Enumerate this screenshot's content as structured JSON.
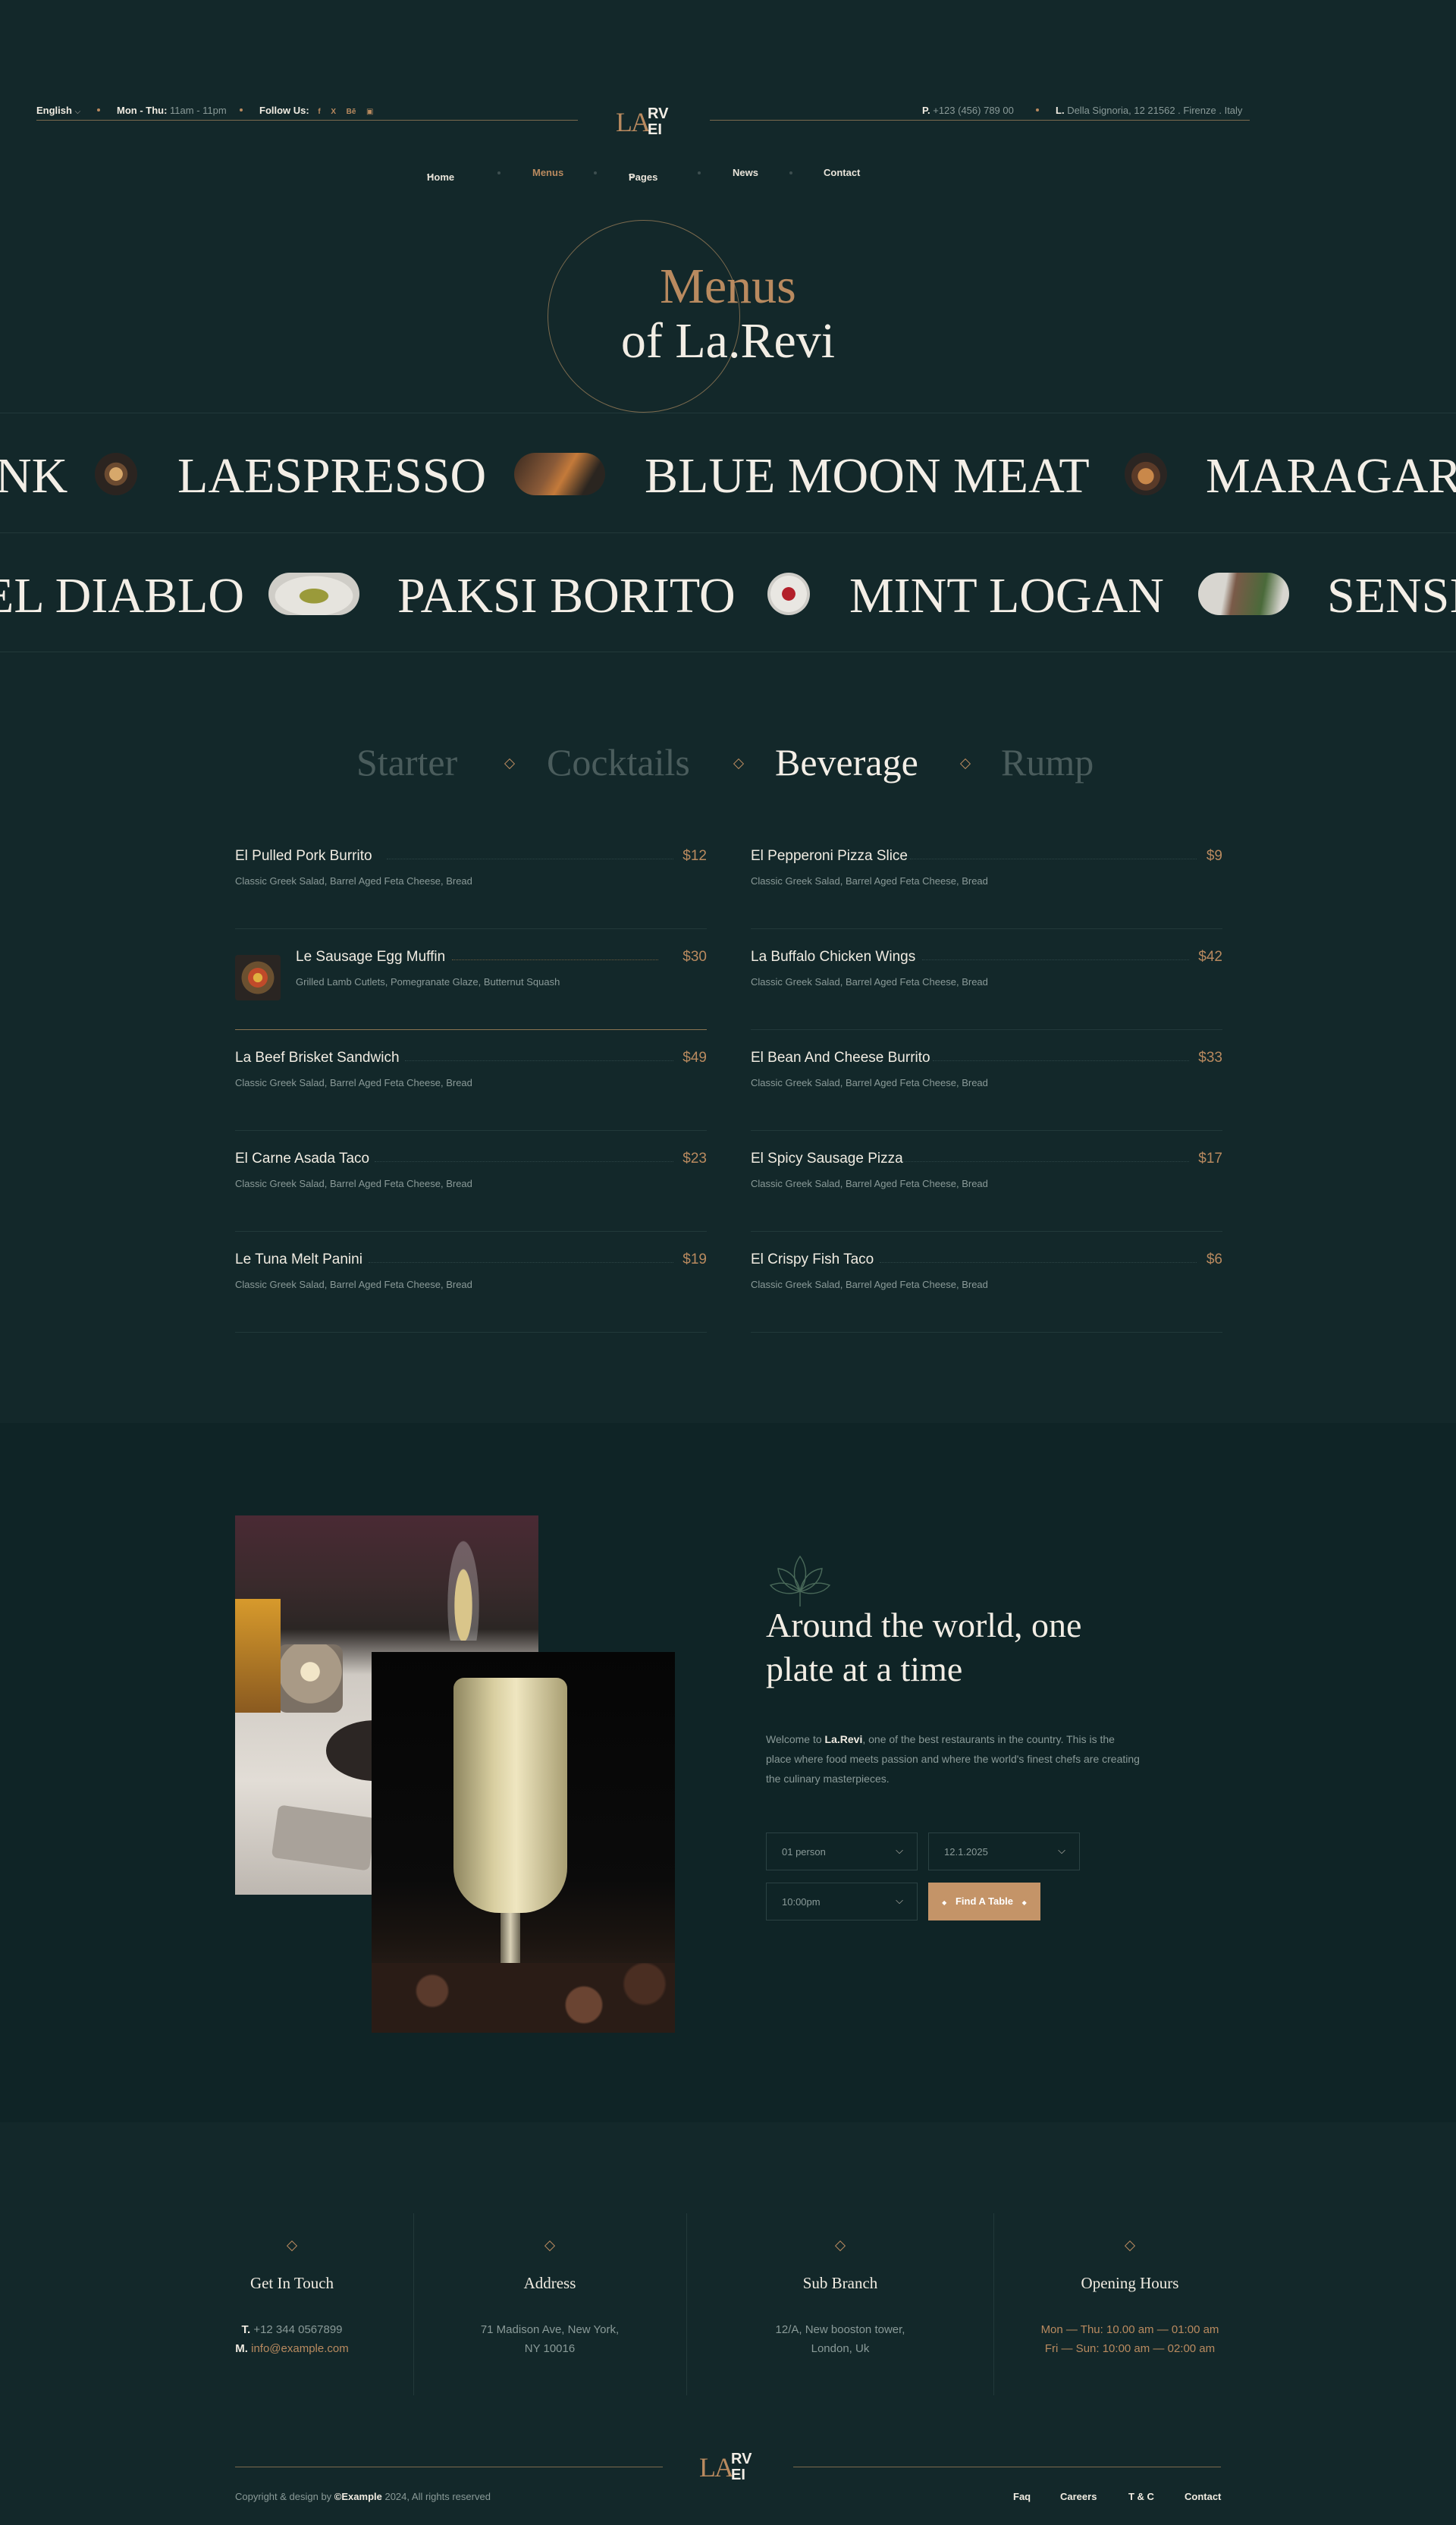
{
  "topbar": {
    "language": "English",
    "hours_label": "Mon - Thu:",
    "hours_value": "11am - 11pm",
    "follow_label": "Follow Us:",
    "socials": [
      "f",
      "X",
      "Bē",
      "▣"
    ],
    "phone_label": "P.",
    "phone_value": "+123 (456) 789 00",
    "location_label": "L.",
    "location_value": "Della Signoria, 12 21562 . Firenze . Italy"
  },
  "logo": {
    "left": "LA",
    "right_top": "RV",
    "right_bottom": "EI"
  },
  "nav": {
    "items": [
      {
        "label": "Home",
        "dropdown": true
      },
      {
        "label": "Menus",
        "dropdown": false,
        "active": true
      },
      {
        "label": "Pages",
        "dropdown": true
      },
      {
        "label": "News",
        "dropdown": false
      },
      {
        "label": "Contact",
        "dropdown": false
      }
    ]
  },
  "hero": {
    "title_line1": "Menus",
    "title_line2": "of La.Revi"
  },
  "marquee": {
    "row1": [
      "NK",
      "LAESPRESSO",
      "BLUE MOON MEAT",
      "MARAGARI"
    ],
    "row2": [
      "EL DIABLO",
      "PAKSI BORITO",
      "MINT LOGAN",
      "SENSI"
    ]
  },
  "tabs": [
    "Starter",
    "Cocktails",
    "Beverage",
    "Rump"
  ],
  "menu": {
    "left": [
      {
        "name": "El Pulled Pork Burrito",
        "price": "$12",
        "desc": "Classic Greek Salad, Barrel Aged Feta Cheese, Bread"
      },
      {
        "name": "Le Sausage Egg Muffin",
        "price": "$30",
        "desc": "Grilled Lamb Cutlets, Pomegranate Glaze, Butternut Squash",
        "featured": true
      },
      {
        "name": "La Beef Brisket Sandwich",
        "price": "$49",
        "desc": "Classic Greek Salad, Barrel Aged Feta Cheese, Bread"
      },
      {
        "name": "El Carne Asada Taco",
        "price": "$23",
        "desc": "Classic Greek Salad, Barrel Aged Feta Cheese, Bread"
      },
      {
        "name": "Le Tuna Melt Panini",
        "price": "$19",
        "desc": "Classic Greek Salad, Barrel Aged Feta Cheese, Bread"
      }
    ],
    "right": [
      {
        "name": "El Pepperoni Pizza Slice",
        "price": "$9",
        "desc": "Classic Greek Salad, Barrel Aged Feta Cheese, Bread"
      },
      {
        "name": "La Buffalo Chicken Wings",
        "price": "$42",
        "desc": "Classic Greek Salad, Barrel Aged Feta Cheese, Bread"
      },
      {
        "name": "El Bean And Cheese Burrito",
        "price": "$33",
        "desc": "Classic Greek Salad, Barrel Aged Feta Cheese, Bread"
      },
      {
        "name": "El Spicy Sausage Pizza",
        "price": "$17",
        "desc": "Classic Greek Salad, Barrel Aged Feta Cheese, Bread"
      },
      {
        "name": "El Crispy Fish Taco",
        "price": "$6",
        "desc": "Classic Greek Salad, Barrel Aged Feta Cheese, Bread"
      }
    ]
  },
  "about": {
    "title_line1": "Around the world, one",
    "title_line2": "plate at a time",
    "body_prefix": "Welcome to ",
    "body_brand": "La.Revi",
    "body_line1_rest": ", one of the best restaurants in the country. This is the",
    "body_line2": "place where food meets passion and where the world's finest chefs are creating",
    "body_line3": "the culinary masterpieces.",
    "persons": "01 person",
    "date": "12.1.2025",
    "time": "10:00pm",
    "button": "Find A Table"
  },
  "footer": {
    "cols": [
      {
        "title": "Get In Touch",
        "line1_label": "T.",
        "line1": "+12 344 0567899",
        "line2_label": "M.",
        "line2": "info@example.com"
      },
      {
        "title": "Address",
        "line1": "71 Madison Ave, New York,",
        "line2": "NY 10016"
      },
      {
        "title": "Sub Branch",
        "line1": "12/A, New booston tower,",
        "line2": "London, Uk"
      },
      {
        "title": "Opening Hours",
        "line1_label": "Mon — Thu:",
        "line1": "10.00 am — 01:00 am",
        "line2_label": "Fri — Sun:",
        "line2": "10:00 am — 02:00 am"
      }
    ],
    "copyright_prefix": "Copyright & design by ",
    "copyright_brand": "©Example",
    "copyright_suffix": " 2024, All rights reserved",
    "links": [
      "Faq",
      "Careers",
      "T & C",
      "Contact"
    ]
  }
}
